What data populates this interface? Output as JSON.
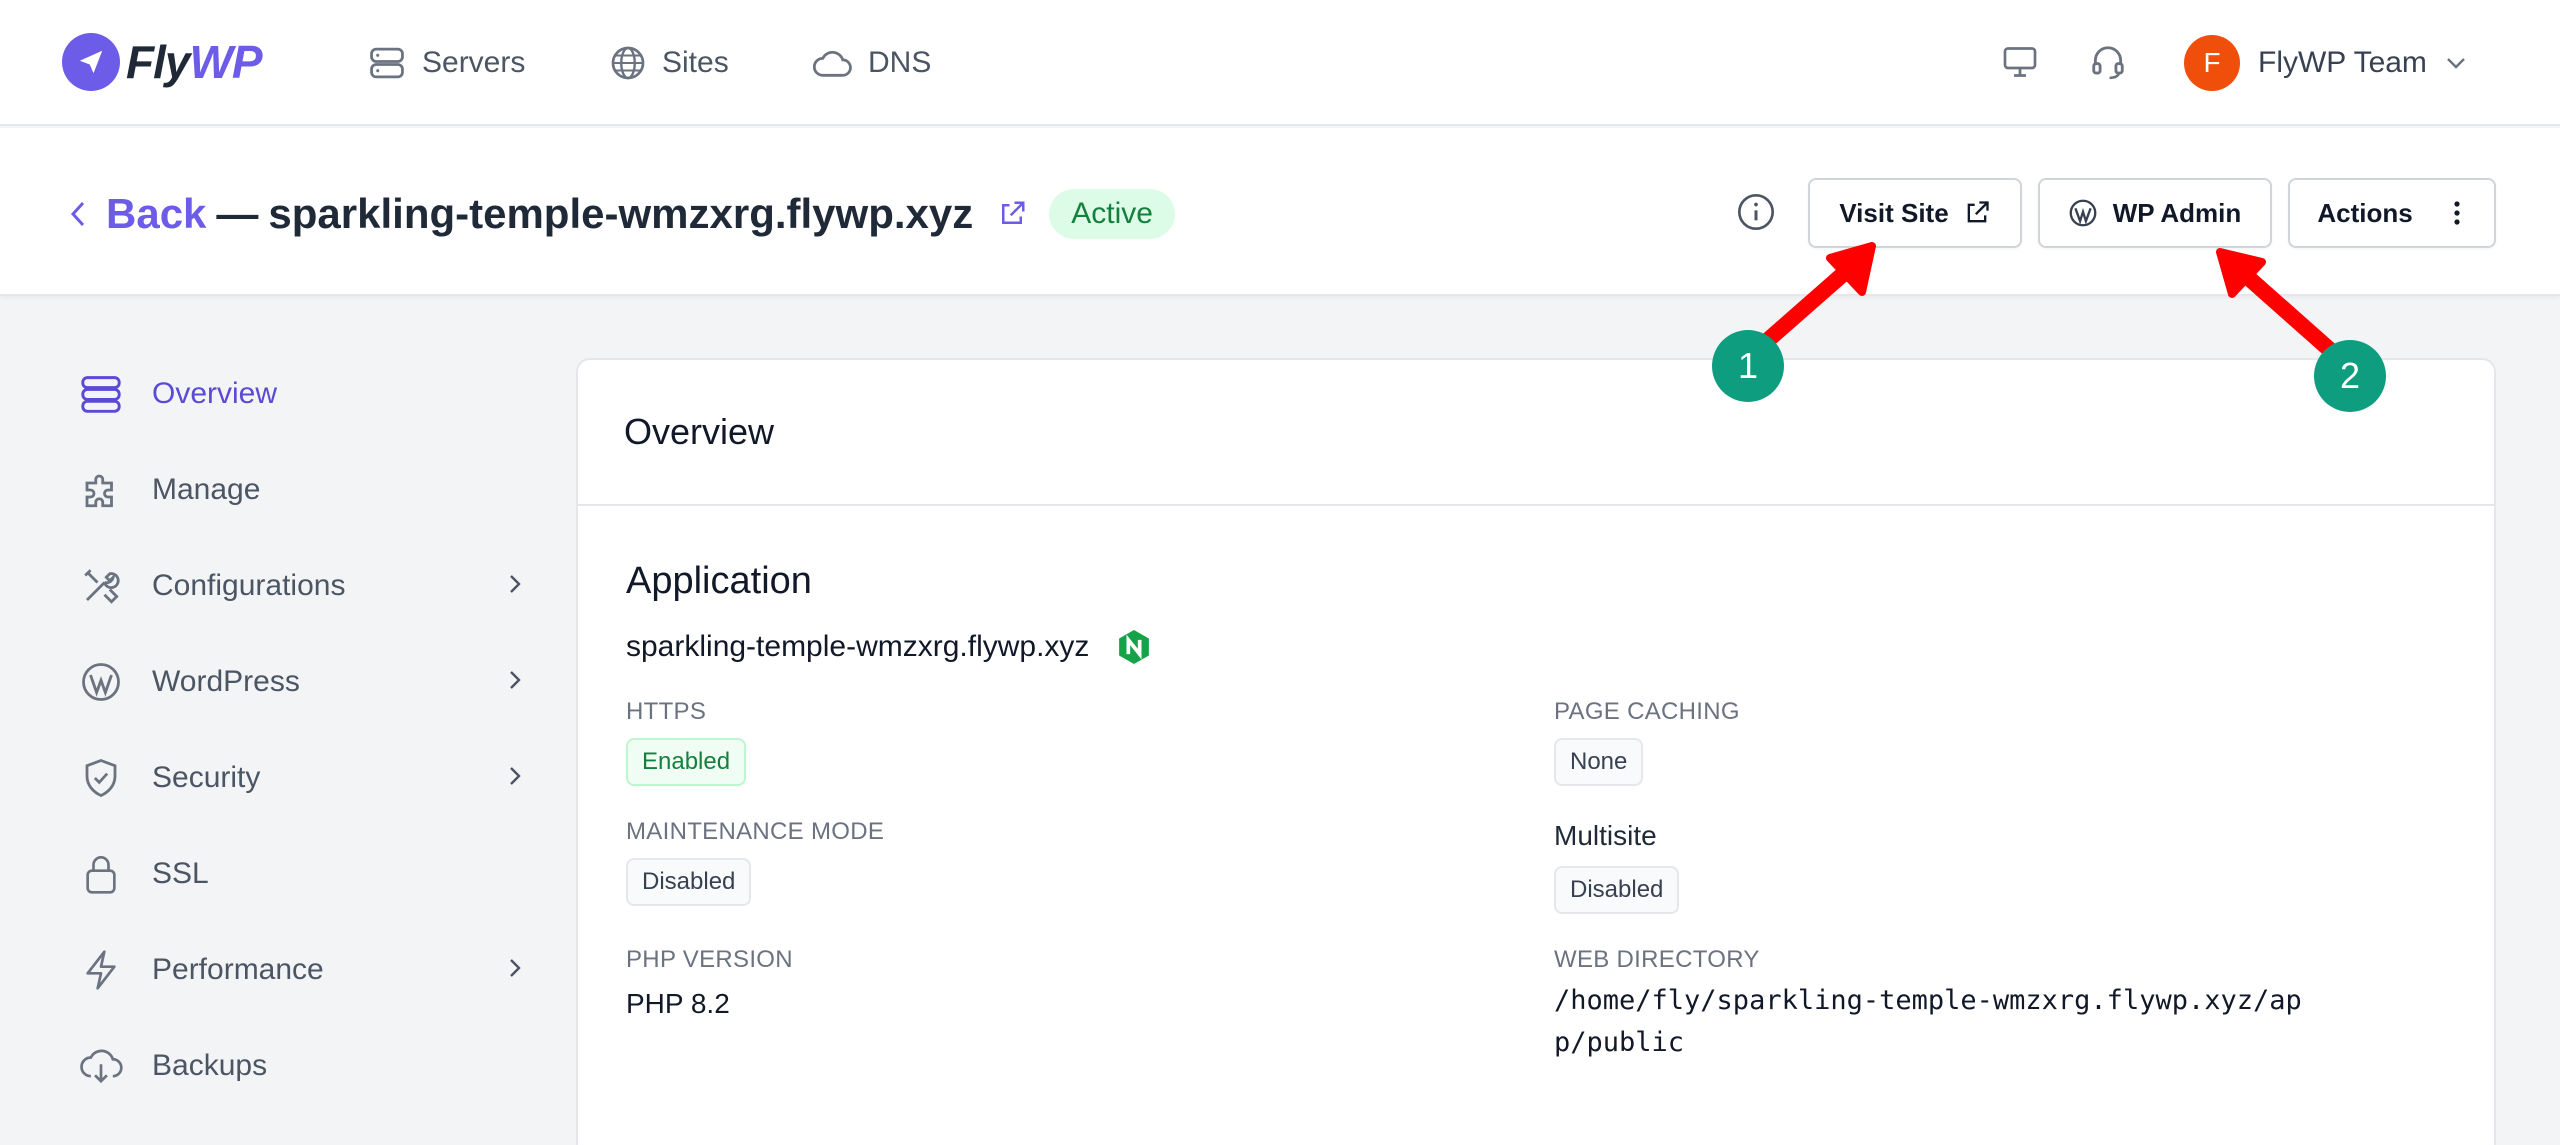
{
  "brand": {
    "fly": "Fly",
    "wp": "WP"
  },
  "nav": {
    "items": [
      {
        "label": "Servers",
        "icon": "server-icon"
      },
      {
        "label": "Sites",
        "icon": "globe-icon"
      },
      {
        "label": "DNS",
        "icon": "cloud-icon"
      }
    ],
    "user": {
      "initial": "F",
      "name": "FlyWP Team"
    }
  },
  "header": {
    "back_label": "Back",
    "separator": "—",
    "site_title": "sparkling-temple-wmzxrg.flywp.xyz",
    "status": "Active",
    "buttons": {
      "visit": "Visit Site",
      "wp_admin": "WP Admin",
      "actions": "Actions"
    }
  },
  "sidebar": {
    "items": [
      {
        "label": "Overview",
        "icon": "server-stack-icon",
        "active": true,
        "has_children": false
      },
      {
        "label": "Manage",
        "icon": "puzzle-icon",
        "active": false,
        "has_children": false
      },
      {
        "label": "Configurations",
        "icon": "tools-icon",
        "active": false,
        "has_children": true
      },
      {
        "label": "WordPress",
        "icon": "wordpress-icon",
        "active": false,
        "has_children": true
      },
      {
        "label": "Security",
        "icon": "shield-icon",
        "active": false,
        "has_children": true
      },
      {
        "label": "SSL",
        "icon": "lock-icon",
        "active": false,
        "has_children": false
      },
      {
        "label": "Performance",
        "icon": "bolt-icon",
        "active": false,
        "has_children": true
      },
      {
        "label": "Backups",
        "icon": "cloud-download-icon",
        "active": false,
        "has_children": false
      }
    ]
  },
  "main": {
    "card_title": "Overview",
    "section_title": "Application",
    "domain": "sparkling-temple-wmzxrg.flywp.xyz",
    "fields": {
      "https_label": "HTTPS",
      "https_value": "Enabled",
      "page_caching_label": "PAGE CACHING",
      "page_caching_value": "None",
      "maintenance_label": "MAINTENANCE MODE",
      "maintenance_value": "Disabled",
      "multisite_label": "Multisite",
      "multisite_value": "Disabled",
      "php_label": "PHP VERSION",
      "php_value": "PHP 8.2",
      "webdir_label": "WEB DIRECTORY",
      "webdir_value": "/home/fly/sparkling-temple-wmzxrg.flywp.xyz/app/public"
    }
  },
  "annotations": {
    "marker_1": "1",
    "marker_2": "2"
  },
  "colors": {
    "accent": "#6d5ce8",
    "active_green": "#15803d",
    "marker": "#0f9d7f",
    "arrow": "#ff0000"
  }
}
